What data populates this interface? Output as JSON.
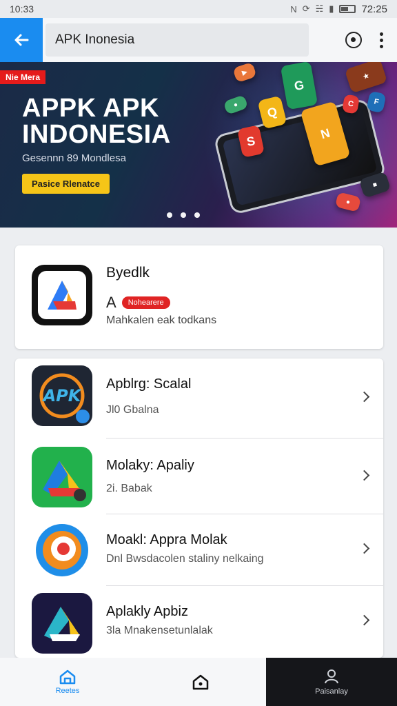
{
  "status_bar": {
    "time_left": "10:33",
    "time_right": "72:25"
  },
  "app_bar": {
    "search_value": "APK Inonesia"
  },
  "banner": {
    "badge": "Nie Mera",
    "title_line1": "APPK APK",
    "title_line2": "INDONESIA",
    "subtitle": "Gesennn 89 Mondlesa",
    "cta": "Pasice Rlenatce",
    "page_dots": 3
  },
  "featured": {
    "name": "Byedlk",
    "letter": "A",
    "tag": "Nohearere",
    "description": "Mahkalen eak todkans"
  },
  "apps": [
    {
      "name": "Apblrg: Scalal",
      "subtitle": "Jl0 Gbalna"
    },
    {
      "name": "Molaky: Apaliy",
      "subtitle": "2i. Babak"
    },
    {
      "name": "Moakl: Appra Molak",
      "subtitle": "Dnl Bwsdacolen staliny nelkaing"
    },
    {
      "name": "Aplakly Apbiz",
      "subtitle": "3la Mnakensetunlalak"
    }
  ],
  "bottom_nav": {
    "home_label": "Reetes",
    "mid_label": "",
    "profile_label": "Paisanlay"
  },
  "colors": {
    "accent": "#1a8cf0",
    "badge_red": "#e02424",
    "cta_yellow": "#f5c518"
  }
}
